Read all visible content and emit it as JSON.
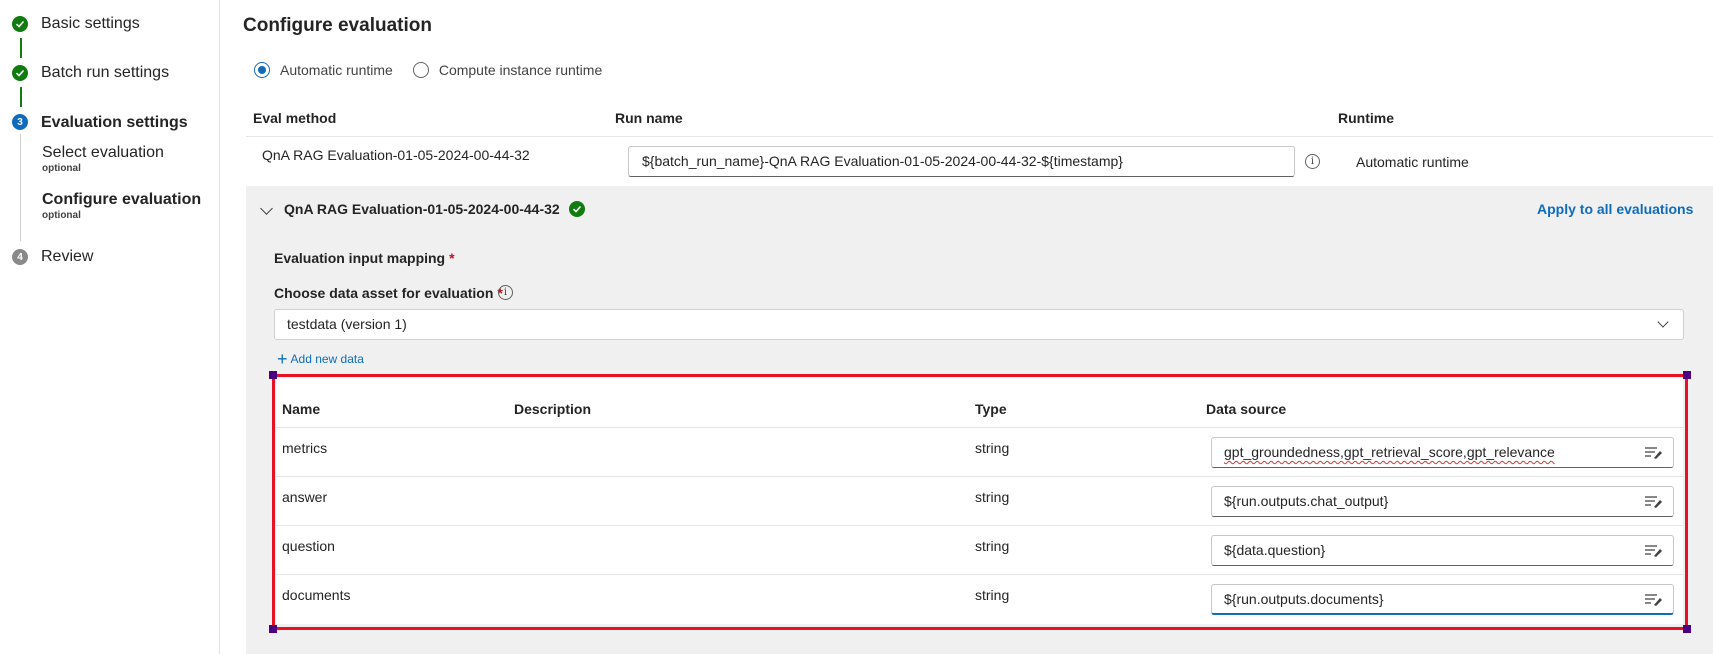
{
  "sidebar": {
    "steps": [
      {
        "label": "Basic settings",
        "state": "done",
        "icon": "check-icon"
      },
      {
        "label": "Batch run settings",
        "state": "done",
        "icon": "check-icon"
      },
      {
        "label": "Evaluation settings",
        "state": "active",
        "number": "3"
      },
      {
        "label": "Review",
        "state": "pending",
        "number": "4"
      }
    ],
    "substeps": [
      {
        "label": "Select evaluation",
        "note": "optional"
      },
      {
        "label": "Configure evaluation",
        "note": "optional"
      }
    ]
  },
  "main": {
    "title": "Configure evaluation",
    "runtime_options": [
      "Automatic runtime",
      "Compute instance runtime"
    ],
    "selected_runtime": "Automatic runtime",
    "columns": {
      "eval_method": "Eval method",
      "run_name": "Run name",
      "runtime": "Runtime"
    },
    "row": {
      "eval_method": "QnA RAG Evaluation-01-05-2024-00-44-32",
      "run_name": "${batch_run_name}-QnA RAG Evaluation-01-05-2024-00-44-32-${timestamp}",
      "runtime": "Automatic runtime"
    },
    "panel": {
      "title": "QnA RAG Evaluation-01-05-2024-00-44-32",
      "apply_link": "Apply to all evaluations",
      "mapping_label": "Evaluation input mapping",
      "data_asset_label": "Choose data asset for evaluation",
      "required_mark": "*",
      "data_asset_value": "testdata (version 1)",
      "add_data": "Add new data",
      "table_headers": {
        "name": "Name",
        "description": "Description",
        "type": "Type",
        "source": "Data source"
      },
      "rows": [
        {
          "name": "metrics",
          "description": "",
          "type": "string",
          "source": "gpt_groundedness,gpt_retrieval_score,gpt_relevance"
        },
        {
          "name": "answer",
          "description": "",
          "type": "string",
          "source": "${run.outputs.chat_output}"
        },
        {
          "name": "question",
          "description": "",
          "type": "string",
          "source": "${data.question}"
        },
        {
          "name": "documents",
          "description": "",
          "type": "string",
          "source": "${run.outputs.documents}"
        }
      ]
    }
  },
  "colors": {
    "accent": "#0f6cbd",
    "success": "#107c10",
    "highlight": "#e81123"
  }
}
